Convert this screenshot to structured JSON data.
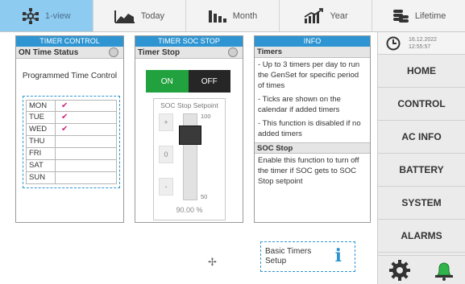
{
  "tabs": [
    {
      "label": "1-view",
      "icon": "network-icon",
      "active": true
    },
    {
      "label": "Today",
      "icon": "area-chart-icon",
      "active": false
    },
    {
      "label": "Month",
      "icon": "bar-chart-icon",
      "active": false
    },
    {
      "label": "Year",
      "icon": "trend-chart-icon",
      "active": false
    },
    {
      "label": "Lifetime",
      "icon": "coin-stack-icon",
      "active": false
    }
  ],
  "timer_control": {
    "header": "TIMER CONTROL",
    "status_label": "ON Time Status",
    "programmed_title": "Programmed Time Control",
    "days": [
      {
        "name": "MON",
        "mark": "✔"
      },
      {
        "name": "TUE",
        "mark": "✔"
      },
      {
        "name": "WED",
        "mark": "✔"
      },
      {
        "name": "THU",
        "mark": ""
      },
      {
        "name": "FRI",
        "mark": ""
      },
      {
        "name": "SAT",
        "mark": ""
      },
      {
        "name": "SUN",
        "mark": ""
      }
    ]
  },
  "soc_stop": {
    "header": "TIMER SOC STOP",
    "status_label": "Timer Stop",
    "on_label": "ON",
    "off_label": "OFF",
    "setpoint_title": "SOC Stop Setpoint",
    "plus_label": "+",
    "zero_label": "0",
    "minus_label": "-",
    "max_label": "100",
    "min_label": "50",
    "value": "90.00 %"
  },
  "info": {
    "header": "INFO",
    "timers_title": "Timers",
    "timers_lines": [
      "- Up to 3 timers per day to run the GenSet for specific period of times",
      "- Ticks are shown on the calendar if added timers",
      "- This function is disabled if no added timers"
    ],
    "soc_title": "SOC Stop",
    "soc_text": "Enable this function to turn off the timer if SOC gets to SOC Stop setpoint"
  },
  "basic_setup": {
    "line1": "Basic Timers",
    "line2": "Setup"
  },
  "sidebar": {
    "date": "16.12.2022",
    "time": "12:55:57",
    "items": [
      "HOME",
      "CONTROL",
      "AC INFO",
      "BATTERY",
      "SYSTEM",
      "ALARMS"
    ]
  },
  "colors": {
    "accent": "#2e95d2",
    "active_tab": "#8ecbf0",
    "on": "#22a23f",
    "alarm_bell": "#2fb34a"
  }
}
